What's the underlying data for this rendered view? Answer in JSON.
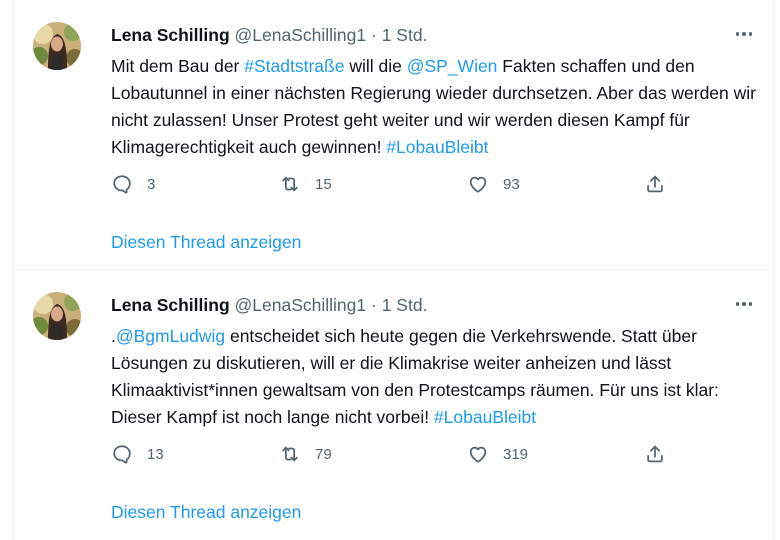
{
  "colors": {
    "link": "#1d9bf0",
    "muted": "#536471",
    "text": "#0f1419",
    "divider": "#eff3f4"
  },
  "tweets": [
    {
      "author_name": "Lena Schilling",
      "handle": "@LenaSchilling1",
      "separator": "·",
      "time": "1 Std.",
      "text_parts": [
        {
          "t": "Mit dem Bau der ",
          "link": false
        },
        {
          "t": "#Stadtstraße",
          "link": true
        },
        {
          "t": " will die ",
          "link": false
        },
        {
          "t": "@SP_Wien",
          "link": true
        },
        {
          "t": " Fakten schaffen und den Lobautunnel in einer nächsten Regierung wieder durchsetzen. Aber das werden wir nicht zulassen! Unser Protest geht weiter und wir werden diesen Kampf für Klimagerechtigkeit auch gewinnen! ",
          "link": false
        },
        {
          "t": "#LobauBleibt",
          "link": true
        }
      ],
      "replies": "3",
      "retweets": "15",
      "likes": "93",
      "thread_link": "Diesen Thread anzeigen"
    },
    {
      "author_name": "Lena Schilling",
      "handle": "@LenaSchilling1",
      "separator": "·",
      "time": "1 Std.",
      "text_parts": [
        {
          "t": ".",
          "link": false
        },
        {
          "t": "@BgmLudwig",
          "link": true
        },
        {
          "t": " entscheidet sich heute gegen die Verkehrswende. Statt über Lösungen zu diskutieren, will er die Klimakrise weiter anheizen und lässt Klimaaktivist*innen gewaltsam von den Protestcamps räumen. Für uns ist klar: Dieser Kampf ist noch lange nicht vorbei! ",
          "link": false
        },
        {
          "t": "#LobauBleibt",
          "link": true
        }
      ],
      "replies": "13",
      "retweets": "79",
      "likes": "319",
      "thread_link": "Diesen Thread anzeigen"
    }
  ],
  "icons": {
    "reply": "reply-icon",
    "retweet": "retweet-icon",
    "like": "like-icon",
    "share": "share-icon",
    "more": "more-icon"
  }
}
